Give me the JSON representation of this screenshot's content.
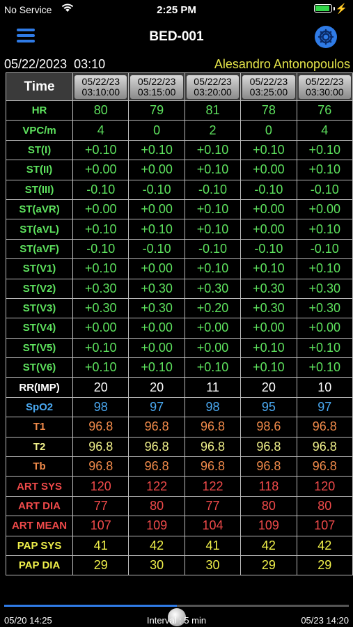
{
  "status_bar": {
    "carrier": "No Service",
    "time": "2:25 PM",
    "battery_level": 0.9,
    "charging_glyph": "⚡"
  },
  "nav": {
    "title": "BED-001",
    "menu_icon": "menu-icon",
    "settings_icon": "gear-icon"
  },
  "header": {
    "date": "05/22/2023",
    "time": "03:10",
    "patient": "Alesandro Antonopoulos"
  },
  "table": {
    "time_label": "Time",
    "columns": [
      [
        "05/22/23",
        "03:10:00"
      ],
      [
        "05/22/23",
        "03:15:00"
      ],
      [
        "05/22/23",
        "03:20:00"
      ],
      [
        "05/22/23",
        "03:25:00"
      ],
      [
        "05/22/23",
        "03:30:00"
      ]
    ],
    "rows": [
      {
        "label": "HR",
        "color": "#5ee35e",
        "values": [
          "80",
          "79",
          "81",
          "78",
          "76"
        ]
      },
      {
        "label": "VPC/m",
        "color": "#5ee35e",
        "values": [
          "4",
          "0",
          "2",
          "0",
          "4"
        ]
      },
      {
        "label": "ST(I)",
        "color": "#5ee35e",
        "values": [
          "+0.10",
          "+0.10",
          "+0.10",
          "+0.10",
          "+0.10"
        ]
      },
      {
        "label": "ST(II)",
        "color": "#5ee35e",
        "values": [
          "+0.00",
          "+0.00",
          "+0.10",
          "+0.00",
          "+0.10"
        ]
      },
      {
        "label": "ST(III)",
        "color": "#5ee35e",
        "values": [
          "-0.10",
          "-0.10",
          "-0.10",
          "-0.10",
          "-0.10"
        ]
      },
      {
        "label": "ST(aVR)",
        "color": "#5ee35e",
        "values": [
          "+0.00",
          "+0.00",
          "+0.10",
          "+0.00",
          "+0.00"
        ]
      },
      {
        "label": "ST(aVL)",
        "color": "#5ee35e",
        "values": [
          "+0.10",
          "+0.10",
          "+0.10",
          "+0.00",
          "+0.10"
        ]
      },
      {
        "label": "ST(aVF)",
        "color": "#5ee35e",
        "values": [
          "-0.10",
          "-0.10",
          "-0.10",
          "-0.10",
          "-0.10"
        ]
      },
      {
        "label": "ST(V1)",
        "color": "#5ee35e",
        "values": [
          "+0.10",
          "+0.00",
          "+0.10",
          "+0.10",
          "+0.10"
        ]
      },
      {
        "label": "ST(V2)",
        "color": "#5ee35e",
        "values": [
          "+0.30",
          "+0.30",
          "+0.30",
          "+0.30",
          "+0.30"
        ]
      },
      {
        "label": "ST(V3)",
        "color": "#5ee35e",
        "values": [
          "+0.30",
          "+0.30",
          "+0.20",
          "+0.30",
          "+0.30"
        ]
      },
      {
        "label": "ST(V4)",
        "color": "#5ee35e",
        "values": [
          "+0.00",
          "+0.00",
          "+0.00",
          "+0.00",
          "+0.00"
        ]
      },
      {
        "label": "ST(V5)",
        "color": "#5ee35e",
        "values": [
          "+0.10",
          "+0.00",
          "+0.00",
          "+0.10",
          "+0.10"
        ]
      },
      {
        "label": "ST(V6)",
        "color": "#5ee35e",
        "values": [
          "+0.10",
          "+0.10",
          "+0.10",
          "+0.10",
          "+0.10"
        ]
      },
      {
        "label": "RR(IMP)",
        "color": "#ffffff",
        "values": [
          "20",
          "20",
          "11",
          "20",
          "10"
        ]
      },
      {
        "label": "SpO2",
        "color": "#4aa8f0",
        "values": [
          "98",
          "97",
          "98",
          "95",
          "97"
        ]
      },
      {
        "label": "T1",
        "color": "#f08a4a",
        "values": [
          "96.8",
          "96.8",
          "96.8",
          "98.6",
          "96.8"
        ]
      },
      {
        "label": "T2",
        "color": "#f0f08a",
        "values": [
          "96.8",
          "96.8",
          "96.8",
          "96.8",
          "96.8"
        ]
      },
      {
        "label": "Tb",
        "color": "#f08a4a",
        "values": [
          "96.8",
          "96.8",
          "96.8",
          "96.8",
          "96.8"
        ]
      },
      {
        "label": "ART SYS",
        "color": "#f04a4a",
        "values": [
          "120",
          "122",
          "122",
          "118",
          "120"
        ]
      },
      {
        "label": "ART DIA",
        "color": "#f04a4a",
        "values": [
          "77",
          "80",
          "77",
          "80",
          "80"
        ]
      },
      {
        "label": "ART MEAN",
        "color": "#f04a4a",
        "values": [
          "107",
          "109",
          "104",
          "109",
          "107"
        ]
      },
      {
        "label": "PAP SYS",
        "color": "#f0f04a",
        "values": [
          "41",
          "42",
          "41",
          "42",
          "42"
        ]
      },
      {
        "label": "PAP DIA",
        "color": "#f0f04a",
        "values": [
          "29",
          "30",
          "30",
          "29",
          "29"
        ]
      }
    ]
  },
  "timeline": {
    "start": "05/20 14:25",
    "interval": "Interval : 5 min",
    "end": "05/23 14:20",
    "position": 0.5
  }
}
